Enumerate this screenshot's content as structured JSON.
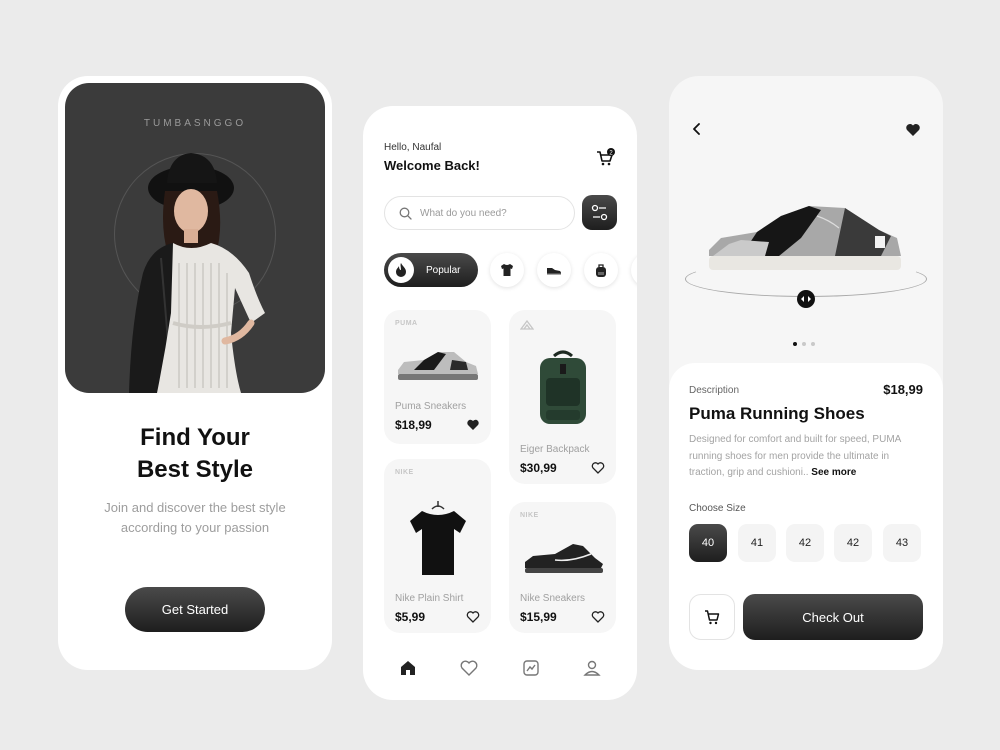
{
  "screen1": {
    "brand": "TUMBASNGGO",
    "title_line1": "Find Your",
    "title_line2": "Best Style",
    "subtitle_line1": "Join and discover the best style",
    "subtitle_line2": "according to your passion",
    "cta_label": "Get Started"
  },
  "screen2": {
    "greeting": "Hello, Naufal",
    "welcome": "Welcome Back!",
    "cart_badge": "2",
    "search_placeholder": "What do you need?",
    "categories": [
      {
        "label": "Popular",
        "icon": "flame-icon",
        "active": true
      },
      {
        "icon": "shirt-icon"
      },
      {
        "icon": "sneaker-icon"
      },
      {
        "icon": "backpack-icon"
      }
    ],
    "products": [
      {
        "brand": "PUMA",
        "name": "Puma Sneakers",
        "price": "$18,99",
        "favorited": true
      },
      {
        "name": "Eiger Backpack",
        "price": "$30,99",
        "favorited": false
      },
      {
        "brand": "NIKE",
        "name": "Nike Plain Shirt",
        "price": "$5,99",
        "favorited": false
      },
      {
        "brand": "NIKE",
        "name": "Nike Sneakers",
        "price": "$15,99",
        "favorited": false
      }
    ],
    "nav": [
      "home-icon",
      "heart-icon",
      "activity-icon",
      "profile-icon"
    ]
  },
  "screen3": {
    "description_label": "Description",
    "price": "$18,99",
    "title": "Puma Running Shoes",
    "description_line1": "Designed for comfort and built for speed, PUMA",
    "description_line2": "running shoes for men provide the ultimate in",
    "description_line3": "traction, grip and cushioni..",
    "see_more": "See more",
    "size_label": "Choose Size",
    "sizes": [
      "40",
      "41",
      "42",
      "42",
      "43"
    ],
    "selected_size": "40",
    "checkout_label": "Check Out",
    "carousel_dots": 3,
    "carousel_active": 0
  },
  "colors": {
    "background": "#ebebeb",
    "dark": "#1e1e1e",
    "muted_text": "#9d9d9d",
    "card": "#f6f6f6"
  }
}
